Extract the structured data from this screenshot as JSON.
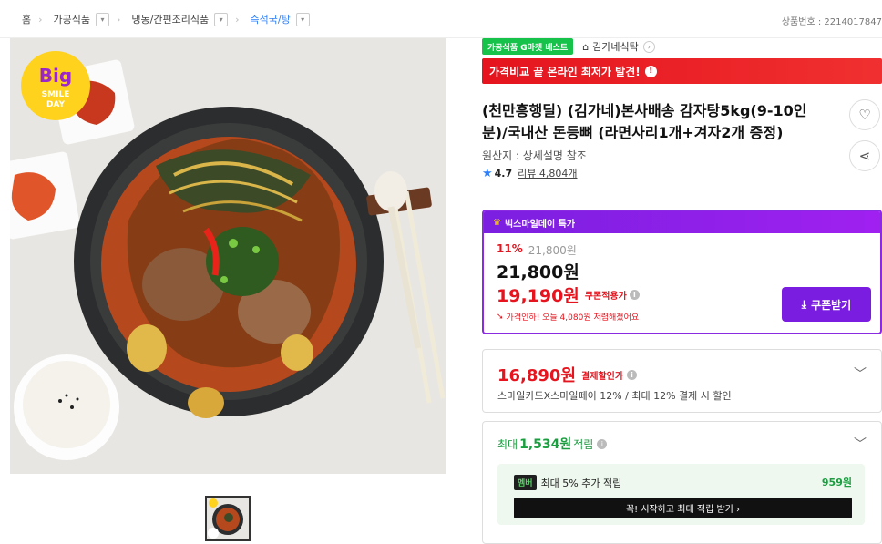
{
  "breadcrumb": {
    "home": "홈",
    "items": [
      {
        "label": "가공식품"
      },
      {
        "label": "냉동/간편조리식품"
      },
      {
        "label": "즉석국/탕"
      }
    ]
  },
  "product_number": "상품번호 : 2214017847",
  "image": {
    "badge_top": "Big",
    "badge_mid": "SMILE",
    "badge_bottom": "DAY"
  },
  "badges": {
    "gmarket": "가공식품 G마켓 베스트",
    "store": "김가네식탁"
  },
  "price_banner": "가격비교 끝 온라인 최저가 발견!",
  "title": "(천만흥행딜) (김가네)본사배송 감자탕5kg(9-10인분)/국내산 돈등뼈 (라면사리1개+겨자2개 증정)",
  "origin": "원산지 : 상세설명 참조",
  "rating": {
    "score": "4.7",
    "reviews": "리뷰 4,804개"
  },
  "deal": {
    "header": "빅스마일데이 특가",
    "discount_pct": "11%",
    "orig_price": "21,800원",
    "price": "21,800원",
    "coupon_price": "19,190원",
    "coupon_label": "쿠폰적용가",
    "note": "가격인하! 오늘 4,080원 저렴해졌어요",
    "coupon_button": "쿠폰받기"
  },
  "payment": {
    "price": "16,890원",
    "label": "결제할인가",
    "desc": "스마일카드X스마일페이 12% / 최대 12% 결제 시 할인"
  },
  "points": {
    "prefix": "최대",
    "amount": "1,534원",
    "suffix": "적립",
    "member_tag": "멤버",
    "member_text": "최대 5% 추가 적립",
    "member_value": "959원",
    "member_button": "꼭! 시작하고 최대 적립 받기 ›"
  },
  "colors": {
    "accent": "#7a1de0",
    "sale": "#e5141e",
    "green": "#16c24a"
  }
}
